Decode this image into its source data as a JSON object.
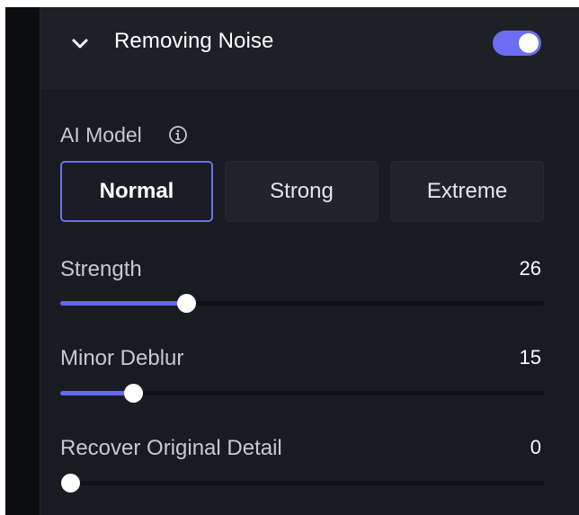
{
  "header": {
    "title": "Removing Noise",
    "enabled": true,
    "icons": {
      "collapse": "chevron-down-icon"
    }
  },
  "colors": {
    "accent": "#6b6ef0",
    "panel_bg": "#181b21",
    "header_bg": "#1d2026",
    "text_primary": "#ffffff",
    "text_secondary": "#c7c9cf"
  },
  "ai_model": {
    "label": "AI Model",
    "info_icon": "info-circle-icon",
    "options": [
      {
        "label": "Normal",
        "selected": true
      },
      {
        "label": "Strong",
        "selected": false
      },
      {
        "label": "Extreme",
        "selected": false
      }
    ]
  },
  "sliders": [
    {
      "label": "Strength",
      "value": "26",
      "fill_fraction": 0.26
    },
    {
      "label": "Minor Deblur",
      "value": "15",
      "fill_fraction": 0.15
    },
    {
      "label": "Recover Original Detail",
      "value": "0",
      "fill_fraction": 0.0
    }
  ]
}
